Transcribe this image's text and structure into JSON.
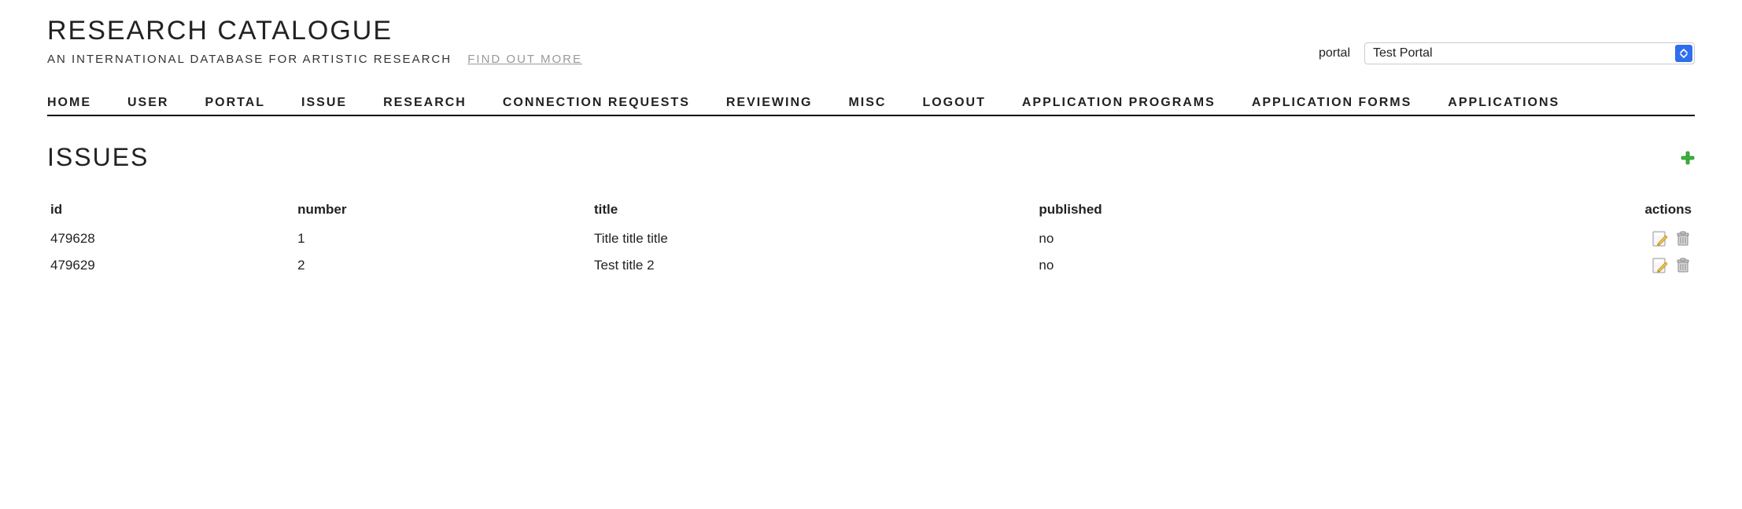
{
  "brand": {
    "title": "RESEARCH CATALOGUE",
    "tagline": "AN INTERNATIONAL DATABASE FOR ARTISTIC RESEARCH",
    "find_out_more": "FIND OUT MORE"
  },
  "portal": {
    "label": "portal",
    "selected": "Test Portal"
  },
  "nav": {
    "home": "HOME",
    "user": "USER",
    "portal": "PORTAL",
    "issue": "ISSUE",
    "research": "RESEARCH",
    "connection_requests": "CONNECTION REQUESTS",
    "reviewing": "REVIEWING",
    "misc": "MISC",
    "logout": "LOGOUT",
    "application_programs": "APPLICATION PROGRAMS",
    "application_forms": "APPLICATION FORMS",
    "applications": "APPLICATIONS"
  },
  "page": {
    "title": "ISSUES"
  },
  "table": {
    "headers": {
      "id": "id",
      "number": "number",
      "title": "title",
      "published": "published",
      "actions": "actions"
    },
    "rows": [
      {
        "id": "479628",
        "number": "1",
        "title": "Title title title",
        "published": "no"
      },
      {
        "id": "479629",
        "number": "2",
        "title": "Test title 2",
        "published": "no"
      }
    ]
  }
}
